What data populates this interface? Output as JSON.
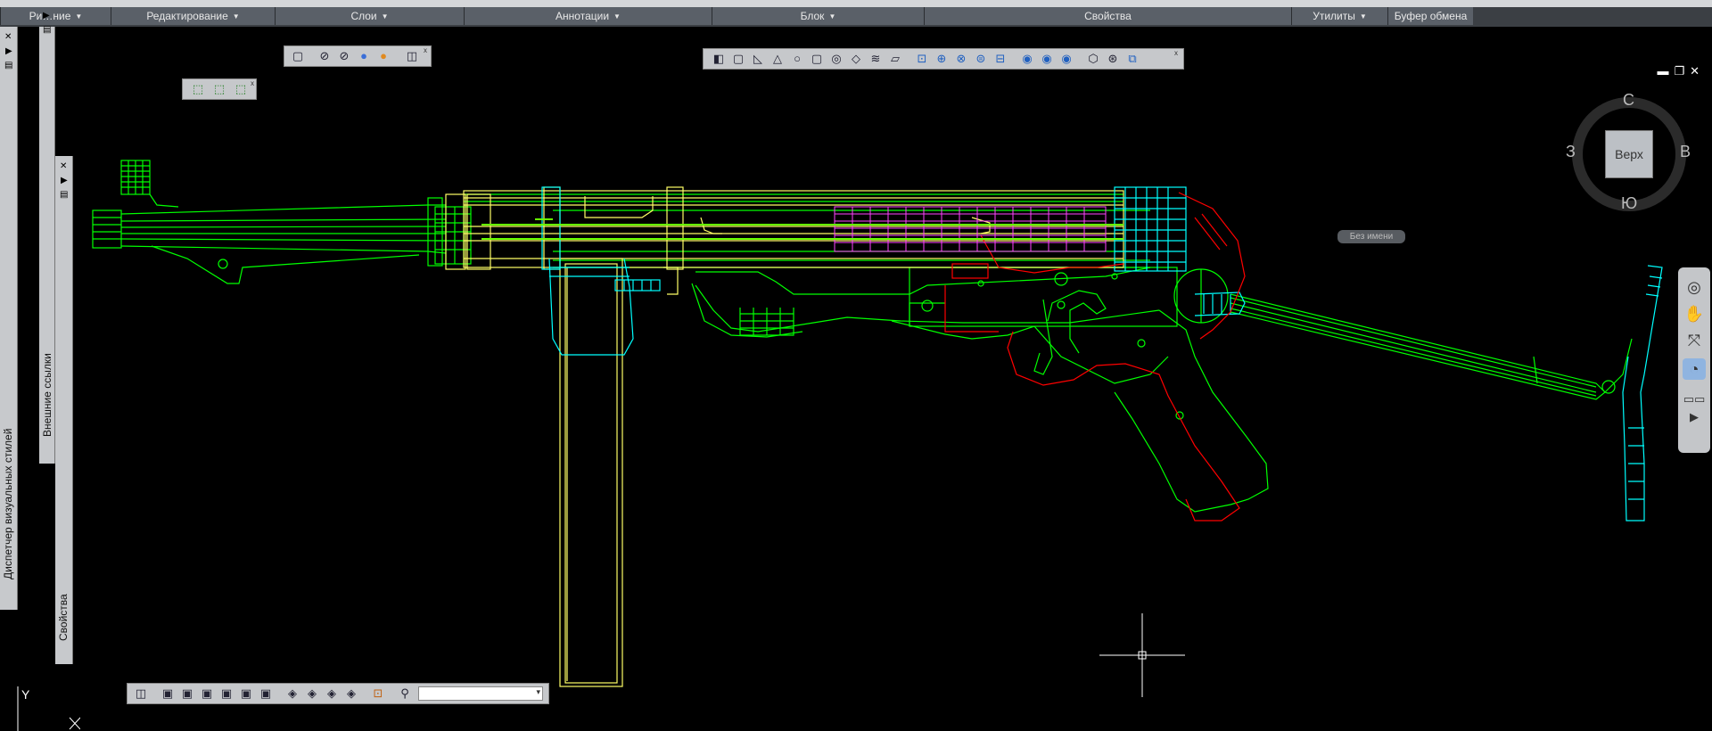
{
  "ribbon": {
    "panels": [
      "Ри…ние",
      "Редактирование",
      "Слои",
      "Аннотации",
      "Блок",
      "Свойства",
      "Утилиты",
      "Буфер обмена"
    ]
  },
  "left_palettes": {
    "visual_styles": "Диспетчер визуальных стилей",
    "xrefs": "Внешние ссылки",
    "properties": "Свойства"
  },
  "viewcube": {
    "top_face": "Верх",
    "north": "С",
    "east": "В",
    "south": "Ю",
    "west": "З"
  },
  "wcs_menu": "Без имени",
  "ucs": {
    "y_label": "Y"
  },
  "colors": {
    "canvas": "#000000",
    "green": "#00ff00",
    "yellow": "#ffff66",
    "cyan": "#00ffff",
    "red": "#ff0000",
    "magenta": "#ff00ff"
  },
  "icons": [
    "close-icon",
    "pin-icon",
    "properties-icon",
    "cube-icon",
    "sphere-icon",
    "orbit-icon",
    "pan-hand-icon",
    "zoom-icon",
    "steering-wheel-icon",
    "camera-icon",
    "dropdown-icon"
  ]
}
